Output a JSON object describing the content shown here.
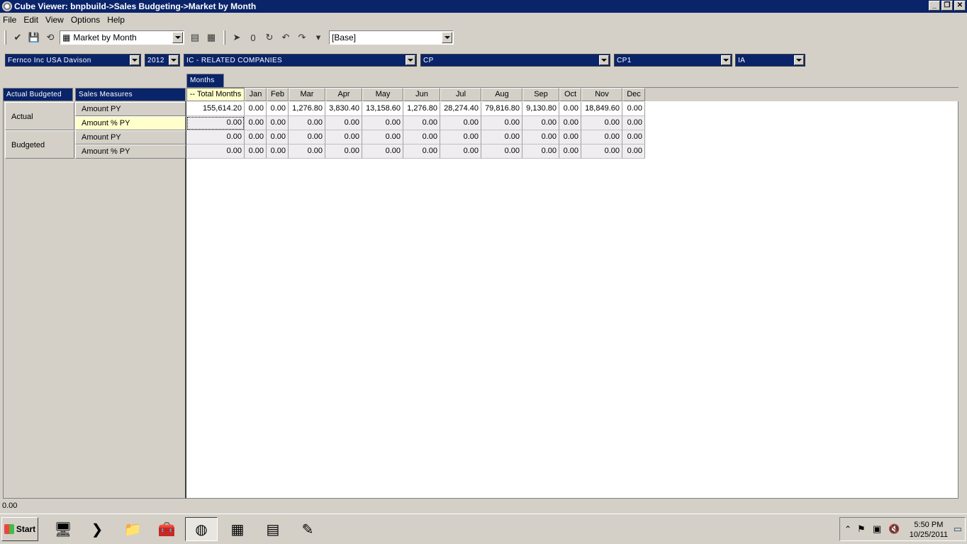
{
  "window": {
    "title": "Cube Viewer: bnpbuild->Sales Budgeting->Market by Month"
  },
  "menu": [
    "File",
    "Edit",
    "View",
    "Options",
    "Help"
  ],
  "toolbar": {
    "view_select": "Market by Month",
    "subset_select": "[Base]"
  },
  "dimensions": [
    "Fernco Inc USA Davison",
    "2012",
    "IC - RELATED COMPANIES",
    "CP",
    "CP1",
    "IA"
  ],
  "pivot": {
    "column_dimension": "Months",
    "row_dimensions": [
      "Actual Budgeted",
      "Sales Measures"
    ]
  },
  "columns": [
    "-- Total Months",
    "Jan",
    "Feb",
    "Mar",
    "Apr",
    "May",
    "Jun",
    "Jul",
    "Aug",
    "Sep",
    "Oct",
    "Nov",
    "Dec"
  ],
  "row_groups": [
    "Actual",
    "Budgeted"
  ],
  "rows": [
    {
      "group": "Actual",
      "measure": "Amount PY",
      "values": [
        "155,614.20",
        "0.00",
        "0.00",
        "1,276.80",
        "3,830.40",
        "13,158.60",
        "1,276.80",
        "28,274.40",
        "79,816.80",
        "9,130.80",
        "0.00",
        "18,849.60",
        "0.00"
      ]
    },
    {
      "group": "Actual",
      "measure": "Amount % PY",
      "values": [
        "0.00",
        "0.00",
        "0.00",
        "0.00",
        "0.00",
        "0.00",
        "0.00",
        "0.00",
        "0.00",
        "0.00",
        "0.00",
        "0.00",
        "0.00"
      ]
    },
    {
      "group": "Budgeted",
      "measure": "Amount PY",
      "values": [
        "0.00",
        "0.00",
        "0.00",
        "0.00",
        "0.00",
        "0.00",
        "0.00",
        "0.00",
        "0.00",
        "0.00",
        "0.00",
        "0.00",
        "0.00"
      ]
    },
    {
      "group": "Budgeted",
      "measure": "Amount % PY",
      "values": [
        "0.00",
        "0.00",
        "0.00",
        "0.00",
        "0.00",
        "0.00",
        "0.00",
        "0.00",
        "0.00",
        "0.00",
        "0.00",
        "0.00",
        "0.00"
      ]
    }
  ],
  "status": {
    "value": "0.00"
  },
  "taskbar": {
    "start_label": "Start",
    "clock_time": "5:50 PM",
    "clock_date": "10/25/2011",
    "icons": [
      "server-manager-icon",
      "powershell-icon",
      "explorer-icon",
      "toolbox-icon",
      "tm1-architect-icon",
      "excel-icon",
      "calculator-icon",
      "notepad-icon"
    ]
  }
}
